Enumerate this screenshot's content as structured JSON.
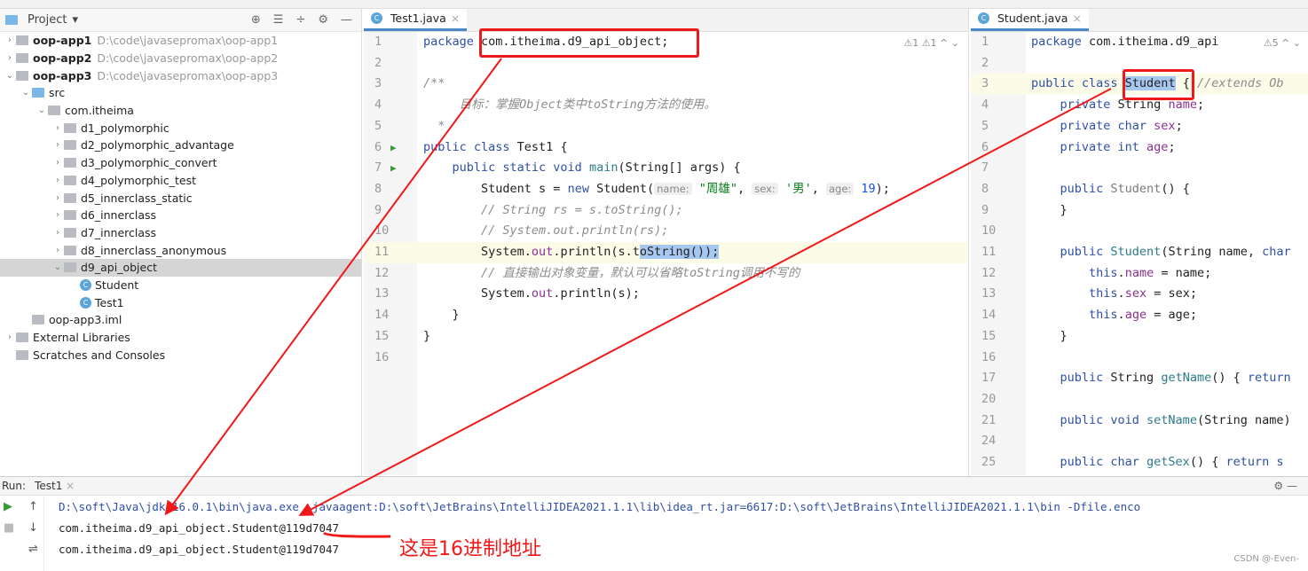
{
  "project": {
    "title": "Project",
    "items": [
      {
        "label": "oop-app1",
        "path": "D:\\code\\javasepromax\\oop-app1",
        "depth": 0,
        "arrow": "›",
        "type": "module",
        "bold": true
      },
      {
        "label": "oop-app2",
        "path": "D:\\code\\javasepromax\\oop-app2",
        "depth": 0,
        "arrow": "›",
        "type": "module",
        "bold": true
      },
      {
        "label": "oop-app3",
        "path": "D:\\code\\javasepromax\\oop-app3",
        "depth": 0,
        "arrow": "⌄",
        "type": "module",
        "bold": true
      },
      {
        "label": "src",
        "depth": 1,
        "arrow": "⌄",
        "type": "src"
      },
      {
        "label": "com.itheima",
        "depth": 2,
        "arrow": "⌄",
        "type": "pkg"
      },
      {
        "label": "d1_polymorphic",
        "depth": 3,
        "arrow": "›",
        "type": "pkg"
      },
      {
        "label": "d2_polymorphic_advantage",
        "depth": 3,
        "arrow": "›",
        "type": "pkg"
      },
      {
        "label": "d3_polymorphic_convert",
        "depth": 3,
        "arrow": "›",
        "type": "pkg"
      },
      {
        "label": "d4_polymorphic_test",
        "depth": 3,
        "arrow": "›",
        "type": "pkg"
      },
      {
        "label": "d5_innerclass_static",
        "depth": 3,
        "arrow": "›",
        "type": "pkg"
      },
      {
        "label": "d6_innerclass",
        "depth": 3,
        "arrow": "›",
        "type": "pkg"
      },
      {
        "label": "d7_innerclass",
        "depth": 3,
        "arrow": "›",
        "type": "pkg"
      },
      {
        "label": "d8_innerclass_anonymous",
        "depth": 3,
        "arrow": "›",
        "type": "pkg"
      },
      {
        "label": "d9_api_object",
        "depth": 3,
        "arrow": "⌄",
        "type": "pkg",
        "selected": true
      },
      {
        "label": "Student",
        "depth": 4,
        "arrow": "",
        "type": "class"
      },
      {
        "label": "Test1",
        "depth": 4,
        "arrow": "",
        "type": "class"
      },
      {
        "label": "oop-app3.iml",
        "depth": 1,
        "arrow": "",
        "type": "file"
      },
      {
        "label": "External Libraries",
        "depth": 0,
        "arrow": "›",
        "type": "lib"
      },
      {
        "label": "Scratches and Consoles",
        "depth": 0,
        "arrow": "",
        "type": "scratch"
      }
    ]
  },
  "editor1": {
    "tab": "Test1.java",
    "warnings": "⚠1  ⚠1  ^  ⌄",
    "current_line": 11,
    "lines": [
      {
        "n": "1",
        "t": [
          [
            "package ",
            "kw"
          ],
          [
            "com.itheima.d9_api_object;",
            ""
          ]
        ]
      },
      {
        "n": "2",
        "t": []
      },
      {
        "n": "3",
        "t": [
          [
            "/**",
            "cm"
          ]
        ]
      },
      {
        "n": "4",
        "t": [
          [
            "     目标：掌握Object类中toString方法的使用。",
            "cm"
          ]
        ]
      },
      {
        "n": "5",
        "t": [
          [
            "  *",
            "cm"
          ]
        ]
      },
      {
        "n": "6",
        "t": [
          [
            "public class ",
            "kw"
          ],
          [
            "Test1 {",
            ""
          ]
        ],
        "run": true
      },
      {
        "n": "7",
        "t": [
          [
            "    public static void ",
            "kw"
          ],
          [
            "main",
            "mth"
          ],
          [
            "(String[] args) {",
            ""
          ]
        ],
        "run": true
      },
      {
        "n": "8",
        "t": [
          [
            "        Student s = ",
            ""
          ],
          [
            "new ",
            "kw"
          ],
          [
            "Student(",
            ""
          ],
          [
            "name:",
            "hint"
          ],
          [
            " \"周雄\"",
            "str"
          ],
          [
            ", ",
            ""
          ],
          [
            "sex:",
            "hint"
          ],
          [
            " '男'",
            "str"
          ],
          [
            ", ",
            ""
          ],
          [
            "age:",
            "hint"
          ],
          [
            " 19",
            "nm"
          ],
          [
            ");",
            ""
          ]
        ]
      },
      {
        "n": "9",
        "t": [
          [
            "        // String rs = s.toString();",
            "cm"
          ]
        ]
      },
      {
        "n": "10",
        "t": [
          [
            "        // System.out.println(rs);",
            "cm"
          ]
        ]
      },
      {
        "n": "11",
        "t": [
          [
            "        System.",
            ""
          ],
          [
            "out",
            "fld"
          ],
          [
            ".println(s.t",
            ""
          ],
          [
            "oString());",
            "selx"
          ]
        ]
      },
      {
        "n": "12",
        "t": [
          [
            "        // 直接输出对象变量，默认可以省略toString调用不写的",
            "cm"
          ]
        ]
      },
      {
        "n": "13",
        "t": [
          [
            "        System.",
            ""
          ],
          [
            "out",
            "fld"
          ],
          [
            ".println(s);",
            ""
          ]
        ]
      },
      {
        "n": "14",
        "t": [
          [
            "    }",
            ""
          ]
        ]
      },
      {
        "n": "15",
        "t": [
          [
            "}",
            ""
          ]
        ]
      },
      {
        "n": "16",
        "t": []
      }
    ]
  },
  "editor2": {
    "tab": "Student.java",
    "warnings": "⚠5  ^  ⌄",
    "current_line": 3,
    "lines": [
      {
        "n": "1",
        "t": [
          [
            "package ",
            "kw"
          ],
          [
            "com.itheima.d9_api",
            ""
          ]
        ]
      },
      {
        "n": "2",
        "t": []
      },
      {
        "n": "3",
        "t": [
          [
            "public class ",
            "kw"
          ],
          [
            "Student",
            "selx"
          ],
          [
            " { ",
            ""
          ],
          [
            "//extends Ob",
            "cm"
          ]
        ]
      },
      {
        "n": "4",
        "t": [
          [
            "    private ",
            "kw"
          ],
          [
            "String ",
            ""
          ],
          [
            "name",
            "fld"
          ],
          [
            ";",
            ""
          ]
        ]
      },
      {
        "n": "5",
        "t": [
          [
            "    private char ",
            "kw"
          ],
          [
            "sex",
            "fld"
          ],
          [
            ";",
            ""
          ]
        ]
      },
      {
        "n": "6",
        "t": [
          [
            "    private int ",
            "kw"
          ],
          [
            "age",
            "fld"
          ],
          [
            ";",
            ""
          ]
        ]
      },
      {
        "n": "7",
        "t": []
      },
      {
        "n": "8",
        "t": [
          [
            "    public ",
            "kw"
          ],
          [
            "Student",
            "grey"
          ],
          [
            "() {",
            ""
          ]
        ]
      },
      {
        "n": "9",
        "t": [
          [
            "    }",
            ""
          ]
        ]
      },
      {
        "n": "10",
        "t": []
      },
      {
        "n": "11",
        "t": [
          [
            "    public ",
            "kw"
          ],
          [
            "Student",
            "mth"
          ],
          [
            "(String name, ",
            ""
          ],
          [
            "char",
            "kw"
          ]
        ]
      },
      {
        "n": "12",
        "t": [
          [
            "        this",
            "kw"
          ],
          [
            ".",
            ""
          ],
          [
            "name",
            "fld"
          ],
          [
            " = name;",
            ""
          ]
        ]
      },
      {
        "n": "13",
        "t": [
          [
            "        this",
            "kw"
          ],
          [
            ".",
            ""
          ],
          [
            "sex",
            "fld"
          ],
          [
            " = sex;",
            ""
          ]
        ]
      },
      {
        "n": "14",
        "t": [
          [
            "        this",
            "kw"
          ],
          [
            ".",
            ""
          ],
          [
            "age",
            "fld"
          ],
          [
            " = age;",
            ""
          ]
        ]
      },
      {
        "n": "15",
        "t": [
          [
            "    }",
            ""
          ]
        ]
      },
      {
        "n": "16",
        "t": []
      },
      {
        "n": "17",
        "t": [
          [
            "    public ",
            "kw"
          ],
          [
            "String ",
            ""
          ],
          [
            "getName",
            "mth"
          ],
          [
            "() { ",
            ""
          ],
          [
            "return",
            "kw"
          ]
        ]
      },
      {
        "n": "20",
        "t": []
      },
      {
        "n": "21",
        "t": [
          [
            "    public void ",
            "kw"
          ],
          [
            "setName",
            "mth"
          ],
          [
            "(String name)",
            ""
          ]
        ]
      },
      {
        "n": "24",
        "t": []
      },
      {
        "n": "25",
        "t": [
          [
            "    public char ",
            "kw"
          ],
          [
            "getSex",
            "mth"
          ],
          [
            "() { ",
            ""
          ],
          [
            "return s",
            "kw"
          ]
        ]
      }
    ]
  },
  "run": {
    "label": "Run:",
    "tab": "Test1",
    "output": [
      "D:\\soft\\Java\\jdk-16.0.1\\bin\\java.exe -javaagent:D:\\soft\\JetBrains\\IntelliJIDEA2021.1.1\\lib\\idea_rt.jar=6617:D:\\soft\\JetBrains\\IntelliJIDEA2021.1.1\\bin -Dfile.enco",
      "com.itheima.d9_api_object.Student@119d7047",
      "com.itheima.d9_api_object.Student@119d7047"
    ]
  },
  "annotation": {
    "note": "这是16进制地址",
    "color": "#f01818"
  },
  "watermark": "CSDN @-Even-"
}
